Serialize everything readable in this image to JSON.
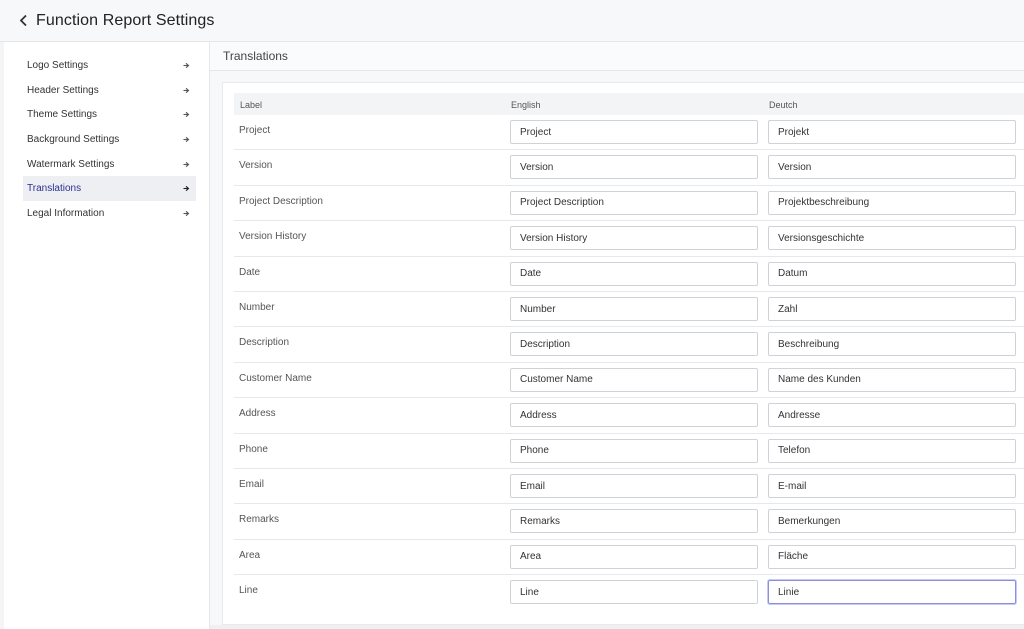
{
  "header": {
    "title": "Function Report Settings"
  },
  "sidebar": {
    "items": [
      {
        "label": "Logo Settings"
      },
      {
        "label": "Header Settings"
      },
      {
        "label": "Theme Settings"
      },
      {
        "label": "Background Settings"
      },
      {
        "label": "Watermark Settings"
      },
      {
        "label": "Translations"
      },
      {
        "label": "Legal Information"
      }
    ],
    "active": "Translations"
  },
  "main": {
    "section_title": "Translations",
    "columns": {
      "label": "Label",
      "english": "English",
      "deutsch": "Deutch"
    },
    "rows": [
      {
        "label": "Project",
        "en": "Project",
        "de": "Projekt"
      },
      {
        "label": "Version",
        "en": "Version",
        "de": "Version"
      },
      {
        "label": "Project Description",
        "en": "Project Description",
        "de": "Projektbeschreibung"
      },
      {
        "label": "Version History",
        "en": "Version History",
        "de": "Versionsgeschichte"
      },
      {
        "label": "Date",
        "en": "Date",
        "de": "Datum"
      },
      {
        "label": "Number",
        "en": "Number",
        "de": "Zahl"
      },
      {
        "label": "Description",
        "en": "Description",
        "de": "Beschreibung"
      },
      {
        "label": "Customer Name",
        "en": "Customer Name",
        "de": "Name des Kunden"
      },
      {
        "label": "Address",
        "en": "Address",
        "de": "Andresse"
      },
      {
        "label": "Phone",
        "en": "Phone",
        "de": "Telefon"
      },
      {
        "label": "Email",
        "en": "Email",
        "de": "E-mail"
      },
      {
        "label": "Remarks",
        "en": "Remarks",
        "de": "Bemerkungen"
      },
      {
        "label": "Area",
        "en": "Area",
        "de": "Fläche"
      },
      {
        "label": "Line",
        "en": "Line",
        "de": "Linie"
      }
    ]
  },
  "colors": {
    "accent": "#2c2f8f",
    "focus_border": "#8a8fe0"
  },
  "icons": {
    "back": "chevron-left-icon",
    "sidebar_item": "arrow-right-icon"
  }
}
